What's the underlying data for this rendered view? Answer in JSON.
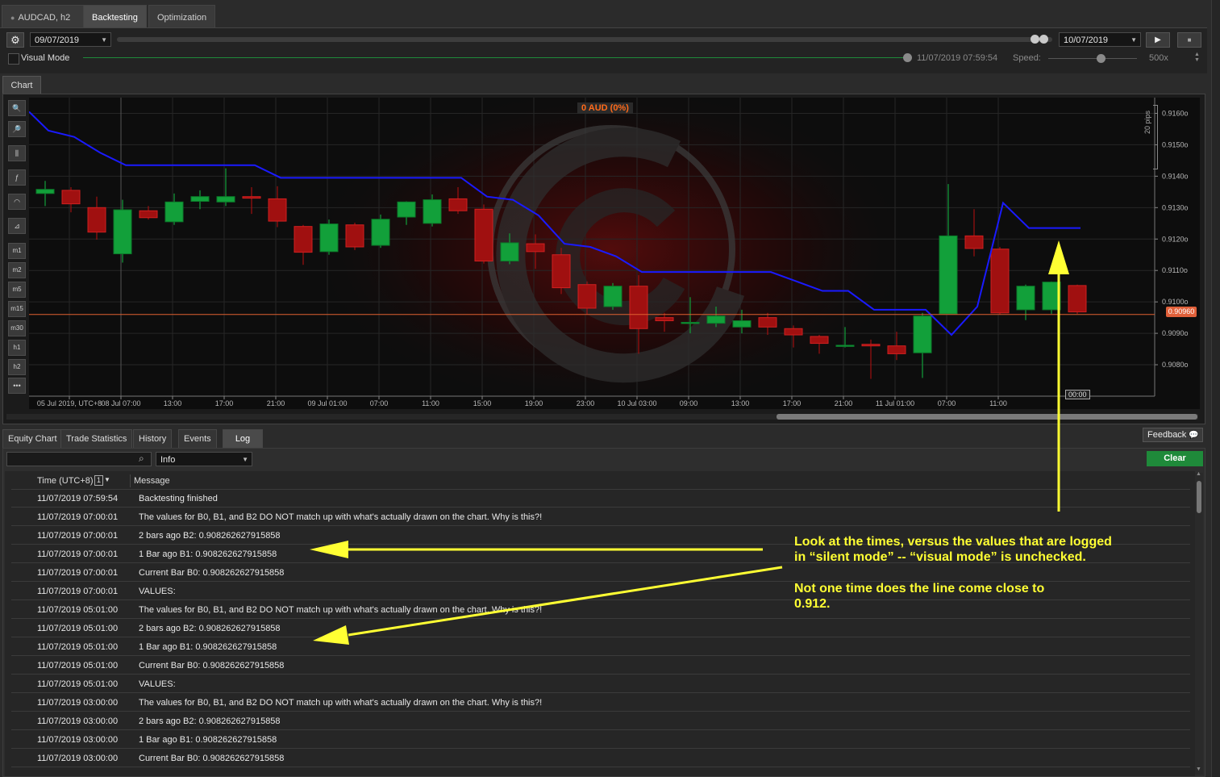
{
  "tabs": [
    {
      "label": "AUDCAD, h2"
    },
    {
      "label": "Backtesting"
    },
    {
      "label": "Optimization"
    }
  ],
  "topbar": {
    "start_date": "09/07/2019",
    "end_date": "10/07/2019",
    "visual_mode_label": "Visual Mode",
    "visual_mode_checked": false,
    "timestamp": "11/07/2019 07:59:54",
    "speed_label": "Speed:",
    "speed_value": "500x"
  },
  "chart": {
    "tab_label": "Chart",
    "pnl_badge": "0 AUD (0%)",
    "range_label": "20 pips",
    "current_price": "0.90960",
    "crosshair_time": "00:00",
    "toolbar_labels": [
      "m1",
      "m2",
      "m5",
      "m15",
      "m30",
      "h1",
      "h2"
    ],
    "colors": {
      "bull": "#12a03a",
      "bear": "#a01010",
      "indicator": "#1a1aff",
      "price_line": "#e06030"
    }
  },
  "chart_data": {
    "type": "candlestick",
    "symbol": "AUDCAD",
    "timeframe": "h2",
    "y_ticks": [
      "0.9160o",
      "0.9150o",
      "0.9140o",
      "0.9130o",
      "0.9120o",
      "0.9110o",
      "0.9100o",
      "0.9090o",
      "0.9080o"
    ],
    "x_ticks": [
      "05 Jul 2019, UTC+8",
      "08 Jul 07:00",
      "13:00",
      "17:00",
      "21:00",
      "09 Jul 01:00",
      "07:00",
      "11:00",
      "15:00",
      "19:00",
      "23:00",
      "10 Jul 03:00",
      "09:00",
      "13:00",
      "17:00",
      "21:00",
      "11 Jul 01:00",
      "07:00",
      "11:00"
    ],
    "ylim": [
      0.907,
      0.9165
    ],
    "candles": [
      {
        "o": 0.91345,
        "c": 0.91358,
        "h": 0.91385,
        "l": 0.91305
      },
      {
        "o": 0.91355,
        "c": 0.91312,
        "h": 0.91365,
        "l": 0.91285
      },
      {
        "o": 0.913,
        "c": 0.91222,
        "h": 0.91335,
        "l": 0.91198
      },
      {
        "o": 0.91153,
        "c": 0.91293,
        "h": 0.91325,
        "l": 0.91125
      },
      {
        "o": 0.9129,
        "c": 0.91268,
        "h": 0.91305,
        "l": 0.91262
      },
      {
        "o": 0.91255,
        "c": 0.91318,
        "h": 0.91345,
        "l": 0.91245
      },
      {
        "o": 0.9132,
        "c": 0.91335,
        "h": 0.91355,
        "l": 0.91295
      },
      {
        "o": 0.91318,
        "c": 0.91335,
        "h": 0.91425,
        "l": 0.91305
      },
      {
        "o": 0.91335,
        "c": 0.9133,
        "h": 0.91365,
        "l": 0.9128
      },
      {
        "o": 0.91328,
        "c": 0.91257,
        "h": 0.91368,
        "l": 0.91238
      },
      {
        "o": 0.9124,
        "c": 0.91158,
        "h": 0.91245,
        "l": 0.91118
      },
      {
        "o": 0.9116,
        "c": 0.91248,
        "h": 0.91262,
        "l": 0.9115
      },
      {
        "o": 0.91245,
        "c": 0.91175,
        "h": 0.91252,
        "l": 0.91165
      },
      {
        "o": 0.9118,
        "c": 0.91263,
        "h": 0.91278,
        "l": 0.91172
      },
      {
        "o": 0.9127,
        "c": 0.91318,
        "h": 0.9132,
        "l": 0.91245
      },
      {
        "o": 0.9125,
        "c": 0.91325,
        "h": 0.91342,
        "l": 0.9124
      },
      {
        "o": 0.91328,
        "c": 0.9129,
        "h": 0.91365,
        "l": 0.9128
      },
      {
        "o": 0.91295,
        "c": 0.9113,
        "h": 0.9131,
        "l": 0.91122
      },
      {
        "o": 0.9113,
        "c": 0.91188,
        "h": 0.91218,
        "l": 0.9112
      },
      {
        "o": 0.91185,
        "c": 0.9116,
        "h": 0.91215,
        "l": 0.91105
      },
      {
        "o": 0.9115,
        "c": 0.91045,
        "h": 0.91172,
        "l": 0.91025
      },
      {
        "o": 0.91055,
        "c": 0.9098,
        "h": 0.91065,
        "l": 0.9096
      },
      {
        "o": 0.90985,
        "c": 0.9105,
        "h": 0.9106,
        "l": 0.90975
      },
      {
        "o": 0.9105,
        "c": 0.90915,
        "h": 0.91085,
        "l": 0.90835
      },
      {
        "o": 0.9095,
        "c": 0.9094,
        "h": 0.90965,
        "l": 0.90905
      },
      {
        "o": 0.90935,
        "c": 0.90935,
        "h": 0.91015,
        "l": 0.909
      },
      {
        "o": 0.90932,
        "c": 0.90955,
        "h": 0.90985,
        "l": 0.9092
      },
      {
        "o": 0.9092,
        "c": 0.9094,
        "h": 0.90975,
        "l": 0.909
      },
      {
        "o": 0.9095,
        "c": 0.9092,
        "h": 0.90965,
        "l": 0.90895
      },
      {
        "o": 0.90915,
        "c": 0.90895,
        "h": 0.90925,
        "l": 0.90855
      },
      {
        "o": 0.9089,
        "c": 0.90868,
        "h": 0.90895,
        "l": 0.90835
      },
      {
        "o": 0.90862,
        "c": 0.90862,
        "h": 0.9092,
        "l": 0.90855
      },
      {
        "o": 0.90865,
        "c": 0.9086,
        "h": 0.9088,
        "l": 0.90755
      },
      {
        "o": 0.9086,
        "c": 0.90835,
        "h": 0.90905,
        "l": 0.90815
      },
      {
        "o": 0.90838,
        "c": 0.90955,
        "h": 0.90965,
        "l": 0.90758
      },
      {
        "o": 0.90962,
        "c": 0.9121,
        "h": 0.91375,
        "l": 0.9096
      },
      {
        "o": 0.9121,
        "c": 0.9117,
        "h": 0.91295,
        "l": 0.91145
      },
      {
        "o": 0.91168,
        "c": 0.90965,
        "h": 0.91175,
        "l": 0.9096
      },
      {
        "o": 0.90975,
        "c": 0.9105,
        "h": 0.91055,
        "l": 0.90942
      },
      {
        "o": 0.90975,
        "c": 0.91063,
        "h": 0.91065,
        "l": 0.90962
      },
      {
        "o": 0.91052,
        "c": 0.90968,
        "h": 0.91055,
        "l": 0.90962
      }
    ],
    "indicator_line": [
      0.91605,
      0.91545,
      0.91525,
      0.91475,
      0.91435,
      0.91435,
      0.91435,
      0.91435,
      0.91435,
      0.91435,
      0.91395,
      0.91395,
      0.91395,
      0.91395,
      0.91395,
      0.91395,
      0.91395,
      0.91395,
      0.91335,
      0.91325,
      0.91275,
      0.91185,
      0.91175,
      0.91145,
      0.91095,
      0.91095,
      0.91095,
      0.91095,
      0.91095,
      0.91095,
      0.91065,
      0.91035,
      0.91035,
      0.90975,
      0.90975,
      0.90975,
      0.90895,
      0.90985,
      0.91315,
      0.91235,
      0.91235,
      0.91235
    ]
  },
  "bottom_tabs": [
    {
      "label": "Equity Chart"
    },
    {
      "label": "Trade Statistics"
    },
    {
      "label": "History"
    },
    {
      "label": "Events"
    },
    {
      "label": "Log"
    }
  ],
  "feedback_label": "Feedback",
  "log": {
    "search_placeholder": "",
    "level": "Info",
    "clear_label": "Clear",
    "columns": {
      "time": "Time (UTC+8)",
      "sort_badge": "1",
      "message": "Message"
    },
    "rows": [
      {
        "time": "11/07/2019 07:59:54",
        "message": "Backtesting finished"
      },
      {
        "time": "11/07/2019 07:00:01",
        "message": "The values for B0, B1, and B2 DO NOT match up with what's actually drawn on the chart. Why is this?!"
      },
      {
        "time": "11/07/2019 07:00:01",
        "message": "2 bars ago B2: 0.908262627915858"
      },
      {
        "time": "11/07/2019 07:00:01",
        "message": "1 Bar ago B1: 0.908262627915858"
      },
      {
        "time": "11/07/2019 07:00:01",
        "message": "Current Bar B0: 0.908262627915858"
      },
      {
        "time": "11/07/2019 07:00:01",
        "message": "VALUES:"
      },
      {
        "time": "11/07/2019 05:01:00",
        "message": "The values for B0, B1, and B2 DO NOT match up with what's actually drawn on the chart. Why is this?!"
      },
      {
        "time": "11/07/2019 05:01:00",
        "message": "2 bars ago B2: 0.908262627915858"
      },
      {
        "time": "11/07/2019 05:01:00",
        "message": "1 Bar ago B1: 0.908262627915858"
      },
      {
        "time": "11/07/2019 05:01:00",
        "message": "Current Bar B0: 0.908262627915858"
      },
      {
        "time": "11/07/2019 05:01:00",
        "message": "VALUES:"
      },
      {
        "time": "11/07/2019 03:00:00",
        "message": "The values for B0, B1, and B2 DO NOT match up with what's actually drawn on the chart. Why is this?!"
      },
      {
        "time": "11/07/2019 03:00:00",
        "message": "2 bars ago B2: 0.908262627915858"
      },
      {
        "time": "11/07/2019 03:00:00",
        "message": "1 Bar ago B1: 0.908262627915858"
      },
      {
        "time": "11/07/2019 03:00:00",
        "message": "Current Bar B0: 0.908262627915858"
      }
    ]
  },
  "annotation": {
    "line1": "Look at the times, versus the values that are logged",
    "line2": "in “silent mode” -- “visual mode” is unchecked.",
    "line3": "Not one time does the line come close to",
    "line4": "0.912.",
    "color": "#ffff33"
  }
}
